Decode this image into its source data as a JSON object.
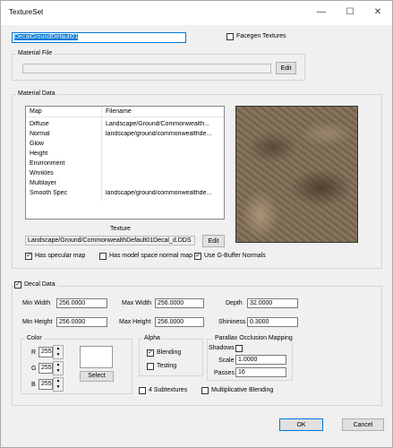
{
  "window": {
    "title": "TextureSet"
  },
  "name_field": {
    "value": "DecalGroundDefault01"
  },
  "facegen": {
    "label": "Facegen Textures",
    "checked": false
  },
  "material_file": {
    "label": "Material File",
    "value": "",
    "edit": "Edit"
  },
  "material_data": {
    "label": "Material Data",
    "columns": [
      "Map",
      "Filename"
    ],
    "rows": [
      {
        "map": "Diffuse",
        "file": "Landscape/Ground/Commonwealth..."
      },
      {
        "map": "Normal",
        "file": "landscape/ground/commonwealthde..."
      },
      {
        "map": "Glow",
        "file": ""
      },
      {
        "map": "Height",
        "file": ""
      },
      {
        "map": "Environment",
        "file": ""
      },
      {
        "map": "Wrinkles",
        "file": ""
      },
      {
        "map": "Multilayer",
        "file": ""
      },
      {
        "map": "Smooth Spec",
        "file": "landscape/ground/commonwealthde..."
      }
    ],
    "texture_label": "Texture",
    "texture_value": "Landscape/Ground/CommonwealthDefault01Decal_d.DDS",
    "texture_edit": "Edit",
    "has_specular": {
      "label": "Has specular map",
      "checked": true
    },
    "has_model_space": {
      "label": "Has model space normal map",
      "checked": false
    },
    "use_gbuffer": {
      "label": "Use G-Buffer Normals",
      "checked": true
    }
  },
  "decal": {
    "label": "Decal Data",
    "checked": true,
    "min_width": {
      "label": "Min Width",
      "value": "256.0000"
    },
    "max_width": {
      "label": "Max Width",
      "value": "256.0000"
    },
    "depth": {
      "label": "Depth",
      "value": "32.0000"
    },
    "min_height": {
      "label": "Min Height",
      "value": "256.0000"
    },
    "max_height": {
      "label": "Max Height",
      "value": "256.0000"
    },
    "shininess": {
      "label": "Shininess",
      "value": "0.3000"
    },
    "color": {
      "label": "Color",
      "r_label": "R",
      "g_label": "G",
      "b_label": "B",
      "r": "255",
      "g": "255",
      "b": "255",
      "select": "Select",
      "swatch": "#ffffff"
    },
    "alpha": {
      "label": "Alpha",
      "blending": "Blending",
      "blending_checked": true,
      "testing": "Testing",
      "testing_checked": false
    },
    "parallax": {
      "label": "Parallax Occlusion Mapping",
      "shadows": "Shadows",
      "shadows_checked": false,
      "scale_label": "Scale",
      "scale": "1.0000",
      "passes_label": "Passes",
      "passes": "16"
    },
    "subtextures": {
      "label": "4 Subtextures",
      "checked": false
    },
    "multiplicative": {
      "label": "Multiplicative Blending",
      "checked": false
    }
  },
  "buttons": {
    "ok": "OK",
    "cancel": "Cancel"
  }
}
